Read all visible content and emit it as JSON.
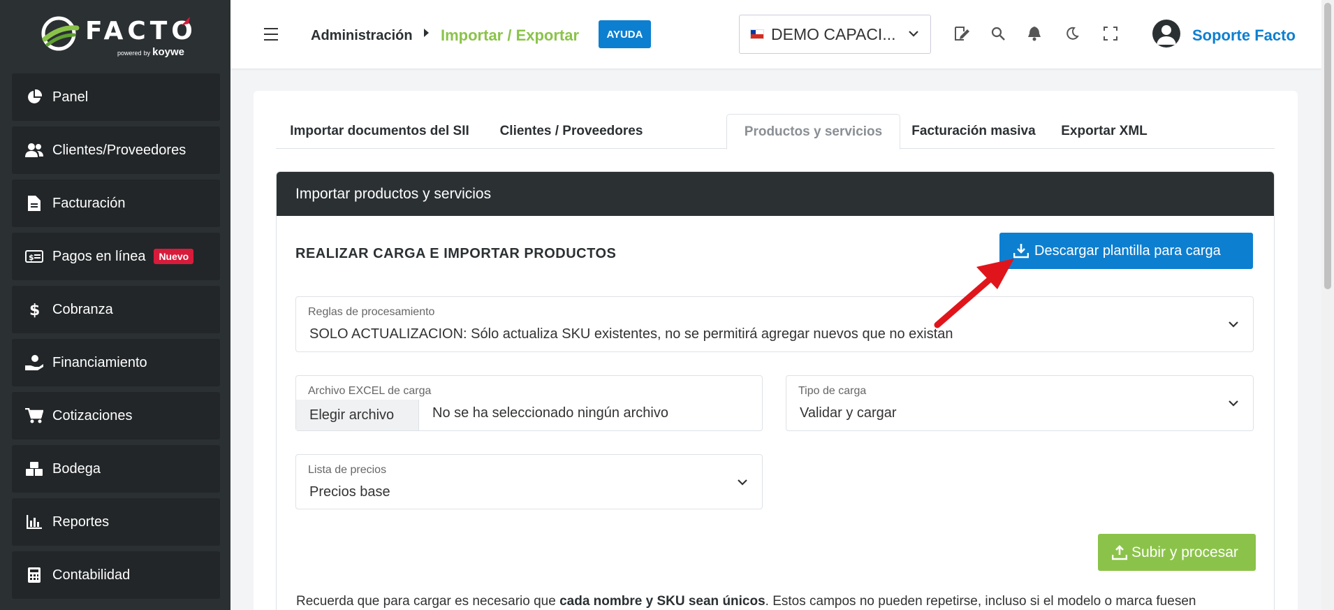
{
  "brand": {
    "name": "FACTO",
    "powered": "powered",
    "by": "by",
    "partner": "koywe",
    "accent_green": "#8bc34a",
    "accent_blue": "#0d7fd0",
    "accent_red": "#d81b3b"
  },
  "sidebar": {
    "items": [
      {
        "label": "Panel",
        "icon": "pie-chart-icon"
      },
      {
        "label": "Clientes/Proveedores",
        "icon": "users-icon"
      },
      {
        "label": "Facturación",
        "icon": "document-icon"
      },
      {
        "label": "Pagos en línea",
        "icon": "money-bill-icon",
        "badge": "Nuevo"
      },
      {
        "label": "Cobranza",
        "icon": "dollar-icon"
      },
      {
        "label": "Financiamiento",
        "icon": "hand-coin-icon"
      },
      {
        "label": "Cotizaciones",
        "icon": "cart-icon"
      },
      {
        "label": "Bodega",
        "icon": "boxes-icon"
      },
      {
        "label": "Reportes",
        "icon": "bar-chart-icon"
      },
      {
        "label": "Contabilidad",
        "icon": "calculator-icon"
      }
    ]
  },
  "header": {
    "breadcrumb_root": "Administración",
    "breadcrumb_current": "Importar / Exportar",
    "help_label": "AYUDA",
    "company": "DEMO CAPACI...",
    "user_name": "Soporte Facto"
  },
  "tabs": [
    {
      "label": "Importar documentos del SII",
      "active": false
    },
    {
      "label": "Clientes / Proveedores",
      "active": false
    },
    {
      "label": "Productos y servicios",
      "active": true
    },
    {
      "label": "Facturación masiva",
      "active": false
    },
    {
      "label": "Exportar XML",
      "active": false
    }
  ],
  "panel": {
    "title": "Importar productos y servicios",
    "section_title": "REALIZAR CARGA E IMPORTAR PRODUCTOS",
    "download_label": "Descargar plantilla para carga",
    "rules_label": "Reglas de procesamiento",
    "rules_value": "SOLO ACTUALIZACION: Sólo actualiza SKU existentes, no se permitirá agregar nuevos que no existan",
    "file_label": "Archivo EXCEL de carga",
    "file_button": "Elegir archivo",
    "file_status": "No se ha seleccionado ningún archivo",
    "load_type_label": "Tipo de carga",
    "load_type_value": "Validar y cargar",
    "price_list_label": "Lista de precios",
    "price_list_value": "Precios base",
    "upload_label": "Subir y procesar",
    "note_pre": "Recuerda que para cargar es necesario que ",
    "note_bold": "cada nombre y SKU sean únicos",
    "note_post": ". Estos campos no pueden repetirse, incluso si el modelo o marca fuesen"
  }
}
